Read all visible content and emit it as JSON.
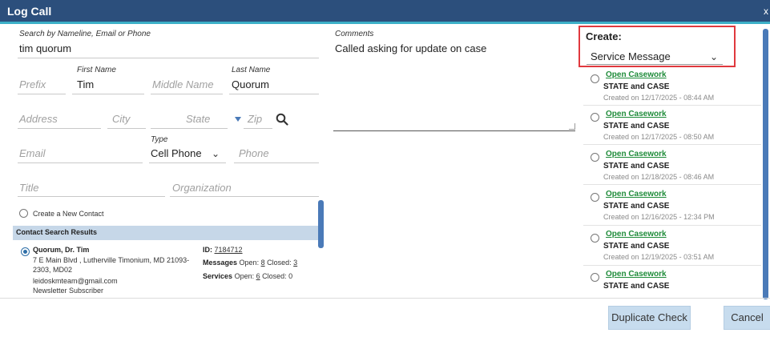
{
  "window": {
    "title": "Log Call",
    "close_glyph": "x"
  },
  "search": {
    "label": "Search by Nameline, Email or Phone",
    "value": "tim quorum"
  },
  "name": {
    "prefix_placeholder": "Prefix",
    "first_label": "First Name",
    "first_value": "Tim",
    "middle_placeholder": "Middle Name",
    "last_label": "Last Name",
    "last_value": "Quorum"
  },
  "address": {
    "address_placeholder": "Address",
    "city_placeholder": "City",
    "state_placeholder": "State",
    "zip_placeholder": "Zip"
  },
  "contact": {
    "email_placeholder": "Email",
    "type_label": "Type",
    "type_value": "Cell Phone",
    "phone_placeholder": "Phone",
    "title_placeholder": "Title",
    "org_placeholder": "Organization"
  },
  "create_new_contact": "Create a New Contact",
  "results": {
    "header": "Contact Search Results",
    "name": "Quorum, Dr. Tim",
    "addr1": "7 E Main Blvd , Lutherville Timonium, MD 21093-",
    "addr2": "2303, MD02",
    "email": "leidoskmteam@gmail.com",
    "tag": "Newsletter Subscriber",
    "id_label": "ID:",
    "id_value": "7184712",
    "messages_label": "Messages",
    "messages_open_label": "Open:",
    "messages_open": "8",
    "messages_closed_label": "Closed:",
    "messages_closed": "3",
    "services_label": "Services",
    "services_open_label": "Open:",
    "services_open": "6",
    "services_closed_label": "Closed:",
    "services_closed": "0"
  },
  "comments": {
    "label": "Comments",
    "value": "Called asking for update on case"
  },
  "create": {
    "label": "Create:",
    "value": "Service Message"
  },
  "casework": [
    {
      "link": "Open Casework",
      "subtitle": "STATE and CASE",
      "created": "Created on 12/17/2025 - 08:44 AM"
    },
    {
      "link": "Open Casework",
      "subtitle": "STATE and CASE",
      "created": "Created on 12/17/2025 - 08:50 AM"
    },
    {
      "link": "Open Casework",
      "subtitle": "STATE and CASE",
      "created": "Created on 12/18/2025 - 08:46 AM"
    },
    {
      "link": "Open Casework",
      "subtitle": "STATE and CASE",
      "created": "Created on 12/16/2025 - 12:34 PM"
    },
    {
      "link": "Open Casework",
      "subtitle": "STATE and CASE",
      "created": "Created on 12/19/2025 - 03:51 AM"
    },
    {
      "link": "Open Casework",
      "subtitle": "STATE and CASE",
      "created": ""
    }
  ],
  "buttons": {
    "duplicate_check": "Duplicate Check",
    "cancel": "Cancel"
  },
  "icons": {
    "search": "search-icon",
    "dropdown": "chevron-down-icon",
    "radio": "radio-icon"
  },
  "colors": {
    "titlebar": "#2c4f7c",
    "accent": "#3db0c8",
    "link": "#1f8c3a",
    "highlight_border": "#e0393e",
    "scrollbar": "#4a7ab8",
    "button": "#c7dcee"
  }
}
